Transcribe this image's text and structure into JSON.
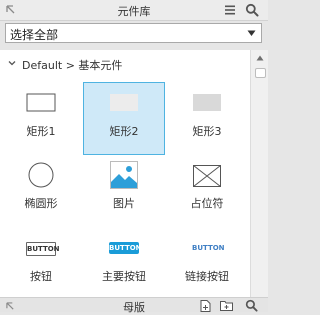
{
  "panel": {
    "title": "元件库",
    "collapse_icon": "collapse-arrow-icon",
    "menu_icon": "hamburger-menu-icon",
    "search_icon": "search-icon"
  },
  "library_select": {
    "value": "选择全部",
    "arrow_icon": "chevron-down-icon"
  },
  "group": {
    "title": "Default > 基本元件",
    "expanded": true
  },
  "widgets": [
    {
      "label": "矩形1",
      "icon": "rectangle-outline-icon",
      "selected": false
    },
    {
      "label": "矩形2",
      "icon": "rectangle-light-fill-icon",
      "selected": true
    },
    {
      "label": "矩形3",
      "icon": "rectangle-gray-fill-icon",
      "selected": false
    },
    {
      "label": "椭圆形",
      "icon": "ellipse-icon",
      "selected": false
    },
    {
      "label": "图片",
      "icon": "image-icon",
      "selected": false
    },
    {
      "label": "占位符",
      "icon": "placeholder-icon",
      "selected": false
    },
    {
      "label": "按钮",
      "icon": "button-preview",
      "preview_text": "BUTTON",
      "selected": false
    },
    {
      "label": "主要按钮",
      "icon": "primary-button-preview",
      "preview_text": "BUTTON",
      "selected": false
    },
    {
      "label": "链接按钮",
      "icon": "link-button-preview",
      "preview_text": "BUTTON",
      "selected": false
    }
  ],
  "bottom_bar": {
    "title": "母版",
    "icons": [
      "add-page-icon",
      "add-folder-icon",
      "search-icon"
    ]
  },
  "colors": {
    "selected_bg": "#cfe9f8",
    "selected_border": "#4eb3e1",
    "primary_button": "#1a9cd8",
    "link_button_text": "#3f7fc4",
    "image_blue": "#2d9fd9"
  }
}
